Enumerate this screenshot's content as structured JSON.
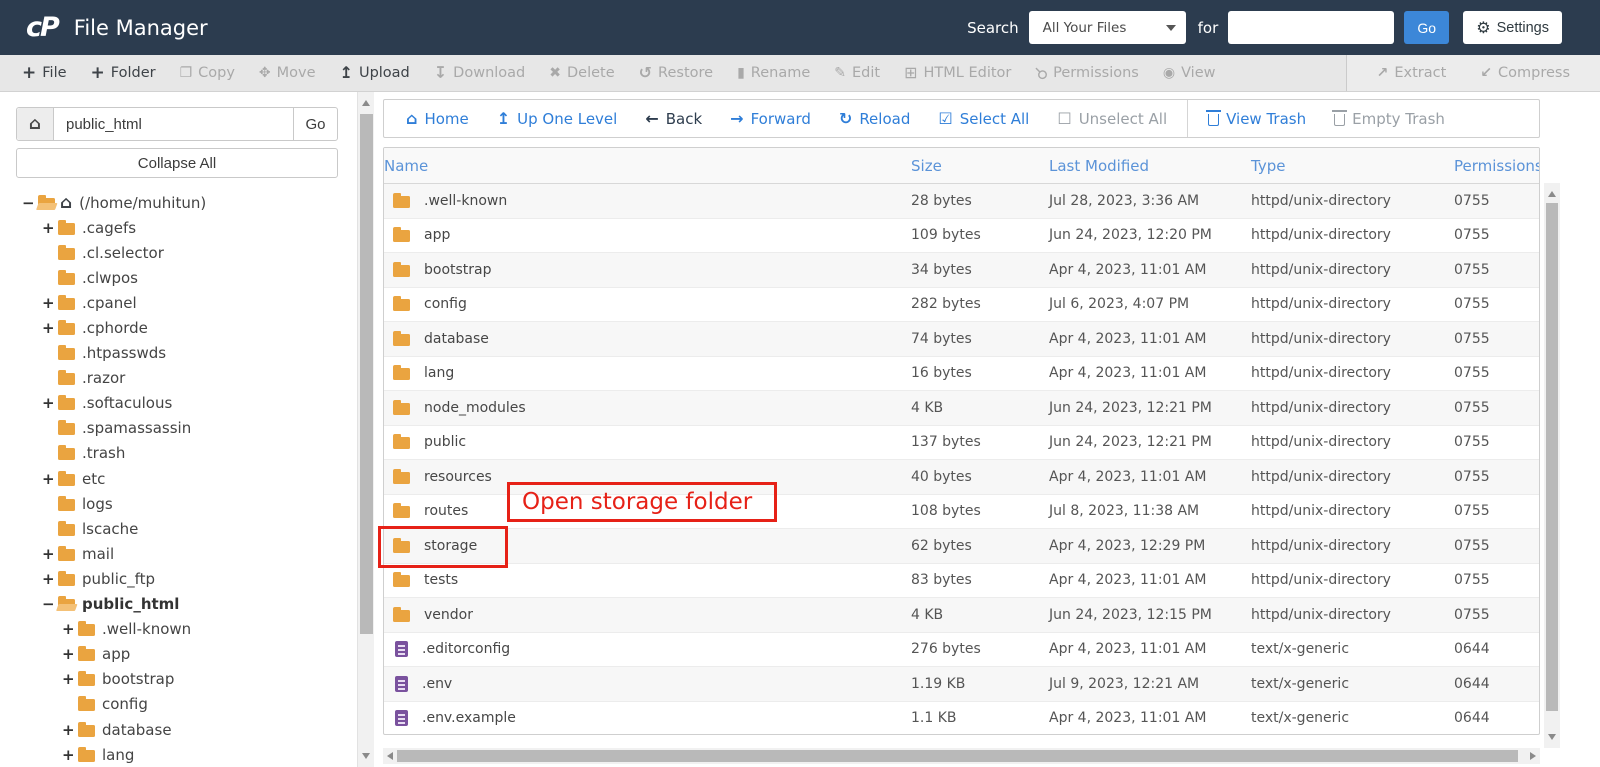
{
  "colors": {
    "topbar_bg": "#2c3c4f",
    "link_blue": "#2f7ed8",
    "table_header_blue": "#5b93d8",
    "annotation_red": "#e62117",
    "folder_orange": "#eaa440",
    "file_purple": "#7a529e",
    "go_button_blue": "#3c87d8"
  },
  "topbar": {
    "logo": "cP",
    "title": "File Manager",
    "search_label": "Search",
    "search_scope": "All Your Files",
    "for_label": "for",
    "search_value": "",
    "go_label": "Go",
    "settings_label": "Settings"
  },
  "toolbar": {
    "main": [
      {
        "label": "File",
        "icon": "plus",
        "cls": "on"
      },
      {
        "label": "Folder",
        "icon": "plus",
        "cls": "on"
      },
      {
        "label": "Copy",
        "icon": "copy",
        "cls": "off"
      },
      {
        "label": "Move",
        "icon": "move",
        "cls": "off"
      },
      {
        "label": "Upload",
        "icon": "upload",
        "cls": "on"
      },
      {
        "label": "Download",
        "icon": "download",
        "cls": "off"
      },
      {
        "label": "Delete",
        "icon": "delete",
        "cls": "off"
      },
      {
        "label": "Restore",
        "icon": "restore",
        "cls": "off"
      },
      {
        "label": "Rename",
        "icon": "rename",
        "cls": "off"
      },
      {
        "label": "Edit",
        "icon": "edit",
        "cls": "off"
      },
      {
        "label": "HTML Editor",
        "icon": "html-editor",
        "cls": "off"
      },
      {
        "label": "Permissions",
        "icon": "permissions",
        "cls": "off"
      },
      {
        "label": "View",
        "icon": "view",
        "cls": "off"
      }
    ],
    "secondary": [
      {
        "label": "Extract",
        "icon": "extract",
        "cls": "off"
      },
      {
        "label": "Compress",
        "icon": "compress",
        "cls": "off"
      }
    ]
  },
  "navbar": {
    "items": [
      {
        "label": "Home",
        "icon": "home",
        "cls": "blue"
      },
      {
        "label": "Up One Level",
        "icon": "up",
        "cls": "blue"
      },
      {
        "label": "Back",
        "icon": "back",
        "cls": "dark"
      },
      {
        "label": "Forward",
        "icon": "forward",
        "cls": "blue"
      },
      {
        "label": "Reload",
        "icon": "reload",
        "cls": "blue"
      },
      {
        "label": "Select All",
        "icon": "check-on",
        "cls": "blue"
      },
      {
        "label": "Unselect All",
        "icon": "check-off",
        "cls": "muted"
      },
      {
        "label": "View Trash",
        "icon": "trash",
        "cls": "blue divided"
      },
      {
        "label": "Empty Trash",
        "icon": "trash",
        "cls": "muted"
      }
    ]
  },
  "sidebar": {
    "path_value": "public_html",
    "go_label": "Go",
    "collapse_all_label": "Collapse All",
    "tree": [
      {
        "label": "(/home/muhitun)",
        "exp": "−",
        "icon": "folder-open",
        "cls": "lvl0 root"
      },
      {
        "label": ".cagefs",
        "exp": "+",
        "icon": "folder",
        "cls": "lvl1"
      },
      {
        "label": ".cl.selector",
        "exp": "",
        "icon": "folder",
        "cls": "lvl1"
      },
      {
        "label": ".clwpos",
        "exp": "",
        "icon": "folder",
        "cls": "lvl1"
      },
      {
        "label": ".cpanel",
        "exp": "+",
        "icon": "folder",
        "cls": "lvl1"
      },
      {
        "label": ".cphorde",
        "exp": "+",
        "icon": "folder",
        "cls": "lvl1"
      },
      {
        "label": ".htpasswds",
        "exp": "",
        "icon": "folder",
        "cls": "lvl1"
      },
      {
        "label": ".razor",
        "exp": "",
        "icon": "folder",
        "cls": "lvl1"
      },
      {
        "label": ".softaculous",
        "exp": "+",
        "icon": "folder",
        "cls": "lvl1"
      },
      {
        "label": ".spamassassin",
        "exp": "",
        "icon": "folder",
        "cls": "lvl1"
      },
      {
        "label": ".trash",
        "exp": "",
        "icon": "folder",
        "cls": "lvl1"
      },
      {
        "label": "etc",
        "exp": "+",
        "icon": "folder",
        "cls": "lvl1"
      },
      {
        "label": "logs",
        "exp": "",
        "icon": "folder",
        "cls": "lvl1"
      },
      {
        "label": "lscache",
        "exp": "",
        "icon": "folder",
        "cls": "lvl1"
      },
      {
        "label": "mail",
        "exp": "+",
        "icon": "folder",
        "cls": "lvl1"
      },
      {
        "label": "public_ftp",
        "exp": "+",
        "icon": "folder",
        "cls": "lvl1"
      },
      {
        "label": "public_html",
        "exp": "−",
        "icon": "folder-open",
        "cls": "lvl1 bold"
      },
      {
        "label": ".well-known",
        "exp": "+",
        "icon": "folder",
        "cls": "lvl2"
      },
      {
        "label": "app",
        "exp": "+",
        "icon": "folder",
        "cls": "lvl2"
      },
      {
        "label": "bootstrap",
        "exp": "+",
        "icon": "folder",
        "cls": "lvl2"
      },
      {
        "label": "config",
        "exp": "",
        "icon": "folder",
        "cls": "lvl2"
      },
      {
        "label": "database",
        "exp": "+",
        "icon": "folder",
        "cls": "lvl2"
      },
      {
        "label": "lang",
        "exp": "+",
        "icon": "folder",
        "cls": "lvl2"
      }
    ]
  },
  "table": {
    "columns": [
      "Name",
      "Size",
      "Last Modified",
      "Type",
      "Permissions"
    ],
    "rows": [
      {
        "name": ".well-known",
        "size": "28 bytes",
        "modified": "Jul 28, 2023, 3:36 AM",
        "type": "httpd/unix-directory",
        "perms": "0755",
        "icon": "folder"
      },
      {
        "name": "app",
        "size": "109 bytes",
        "modified": "Jun 24, 2023, 12:20 PM",
        "type": "httpd/unix-directory",
        "perms": "0755",
        "icon": "folder"
      },
      {
        "name": "bootstrap",
        "size": "34 bytes",
        "modified": "Apr 4, 2023, 11:01 AM",
        "type": "httpd/unix-directory",
        "perms": "0755",
        "icon": "folder"
      },
      {
        "name": "config",
        "size": "282 bytes",
        "modified": "Jul 6, 2023, 4:07 PM",
        "type": "httpd/unix-directory",
        "perms": "0755",
        "icon": "folder"
      },
      {
        "name": "database",
        "size": "74 bytes",
        "modified": "Apr 4, 2023, 11:01 AM",
        "type": "httpd/unix-directory",
        "perms": "0755",
        "icon": "folder"
      },
      {
        "name": "lang",
        "size": "16 bytes",
        "modified": "Apr 4, 2023, 11:01 AM",
        "type": "httpd/unix-directory",
        "perms": "0755",
        "icon": "folder"
      },
      {
        "name": "node_modules",
        "size": "4 KB",
        "modified": "Jun 24, 2023, 12:21 PM",
        "type": "httpd/unix-directory",
        "perms": "0755",
        "icon": "folder"
      },
      {
        "name": "public",
        "size": "137 bytes",
        "modified": "Jun 24, 2023, 12:21 PM",
        "type": "httpd/unix-directory",
        "perms": "0755",
        "icon": "folder"
      },
      {
        "name": "resources",
        "size": "40 bytes",
        "modified": "Apr 4, 2023, 11:01 AM",
        "type": "httpd/unix-directory",
        "perms": "0755",
        "icon": "folder"
      },
      {
        "name": "routes",
        "size": "108 bytes",
        "modified": "Jul 8, 2023, 11:38 AM",
        "type": "httpd/unix-directory",
        "perms": "0755",
        "icon": "folder"
      },
      {
        "name": "storage",
        "size": "62 bytes",
        "modified": "Apr 4, 2023, 12:29 PM",
        "type": "httpd/unix-directory",
        "perms": "0755",
        "icon": "folder"
      },
      {
        "name": "tests",
        "size": "83 bytes",
        "modified": "Apr 4, 2023, 11:01 AM",
        "type": "httpd/unix-directory",
        "perms": "0755",
        "icon": "folder"
      },
      {
        "name": "vendor",
        "size": "4 KB",
        "modified": "Jun 24, 2023, 12:15 PM",
        "type": "httpd/unix-directory",
        "perms": "0755",
        "icon": "folder"
      },
      {
        "name": ".editorconfig",
        "size": "276 bytes",
        "modified": "Apr 4, 2023, 11:01 AM",
        "type": "text/x-generic",
        "perms": "0644",
        "icon": "file"
      },
      {
        "name": ".env",
        "size": "1.19 KB",
        "modified": "Jul 9, 2023, 12:21 AM",
        "type": "text/x-generic",
        "perms": "0644",
        "icon": "file"
      },
      {
        "name": ".env.example",
        "size": "1.1 KB",
        "modified": "Apr 4, 2023, 11:01 AM",
        "type": "text/x-generic",
        "perms": "0644",
        "icon": "file"
      }
    ]
  },
  "annotation": {
    "label": "Open storage folder"
  }
}
